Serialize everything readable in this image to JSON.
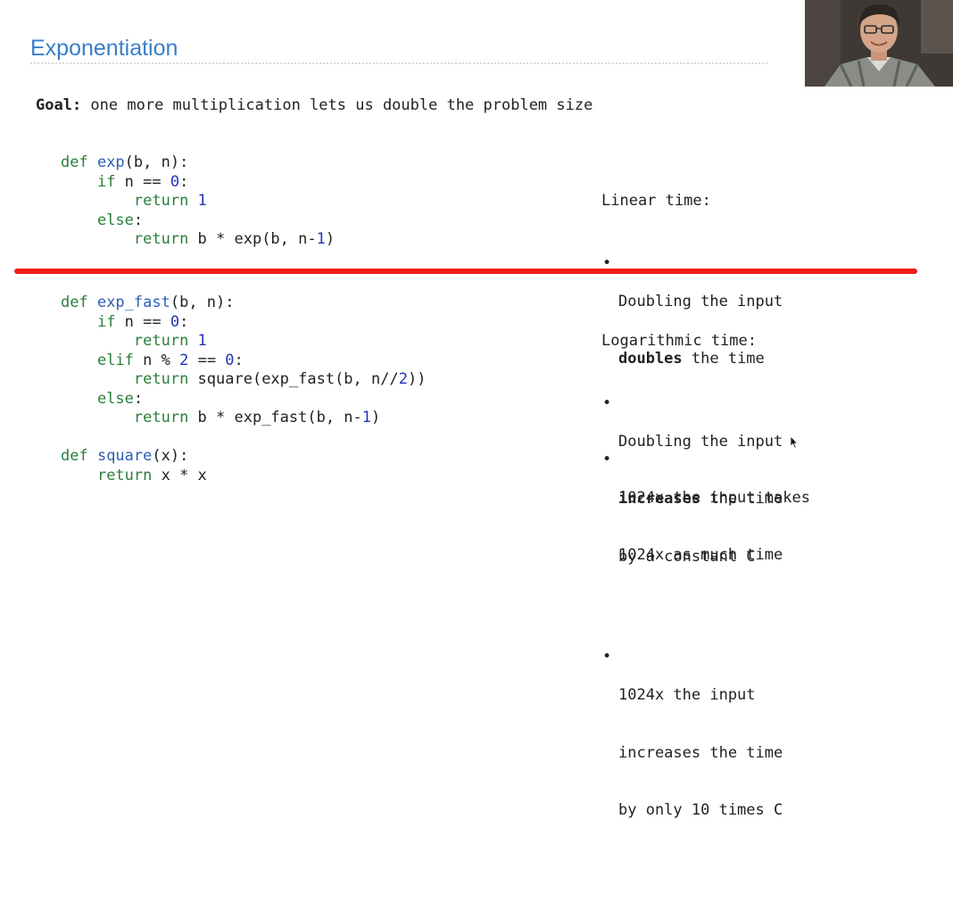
{
  "slide": {
    "title": "Exponentiation",
    "goal_label": "Goal:",
    "goal_text": " one more multiplication lets us double the problem size"
  },
  "linear": {
    "code": [
      [
        {
          "t": "def ",
          "c": "kw"
        },
        {
          "t": "exp",
          "c": "fn"
        },
        {
          "t": "(b, n):",
          "c": ""
        }
      ],
      [
        {
          "t": "    ",
          "c": ""
        },
        {
          "t": "if",
          "c": "kw"
        },
        {
          "t": " n == ",
          "c": ""
        },
        {
          "t": "0",
          "c": "num"
        },
        {
          "t": ":",
          "c": ""
        }
      ],
      [
        {
          "t": "        ",
          "c": ""
        },
        {
          "t": "return ",
          "c": "kw"
        },
        {
          "t": "1",
          "c": "num"
        }
      ],
      [
        {
          "t": "    ",
          "c": ""
        },
        {
          "t": "else",
          "c": "kw"
        },
        {
          "t": ":",
          "c": ""
        }
      ],
      [
        {
          "t": "        ",
          "c": ""
        },
        {
          "t": "return",
          "c": "kw"
        },
        {
          "t": " b * exp(b, n-",
          "c": ""
        },
        {
          "t": "1",
          "c": "num"
        },
        {
          "t": ")",
          "c": ""
        }
      ]
    ],
    "heading": "Linear time:",
    "bullet1_line1": "Doubling the input",
    "bullet1_bold": "doubles",
    "bullet1_rest": " the time",
    "bullet2_line1": "1024x the input takes",
    "bullet2_line2": "1024x as much time"
  },
  "logarithmic": {
    "code": [
      [
        {
          "t": "def ",
          "c": "kw"
        },
        {
          "t": "exp_fast",
          "c": "fn"
        },
        {
          "t": "(b, n):",
          "c": ""
        }
      ],
      [
        {
          "t": "    ",
          "c": ""
        },
        {
          "t": "if",
          "c": "kw"
        },
        {
          "t": " n == ",
          "c": ""
        },
        {
          "t": "0",
          "c": "num"
        },
        {
          "t": ":",
          "c": ""
        }
      ],
      [
        {
          "t": "        ",
          "c": ""
        },
        {
          "t": "return ",
          "c": "kw"
        },
        {
          "t": "1",
          "c": "num"
        }
      ],
      [
        {
          "t": "    ",
          "c": ""
        },
        {
          "t": "elif",
          "c": "kw"
        },
        {
          "t": " n % ",
          "c": ""
        },
        {
          "t": "2",
          "c": "num"
        },
        {
          "t": " == ",
          "c": ""
        },
        {
          "t": "0",
          "c": "num"
        },
        {
          "t": ":",
          "c": ""
        }
      ],
      [
        {
          "t": "        ",
          "c": ""
        },
        {
          "t": "return",
          "c": "kw"
        },
        {
          "t": " square(exp_fast(b, n//",
          "c": ""
        },
        {
          "t": "2",
          "c": "num"
        },
        {
          "t": "))",
          "c": ""
        }
      ],
      [
        {
          "t": "    ",
          "c": ""
        },
        {
          "t": "else",
          "c": "kw"
        },
        {
          "t": ":",
          "c": ""
        }
      ],
      [
        {
          "t": "        ",
          "c": ""
        },
        {
          "t": "return",
          "c": "kw"
        },
        {
          "t": " b * exp_fast(b, n-",
          "c": ""
        },
        {
          "t": "1",
          "c": "num"
        },
        {
          "t": ")",
          "c": ""
        }
      ],
      [],
      [
        {
          "t": "def ",
          "c": "kw"
        },
        {
          "t": "square",
          "c": "fn"
        },
        {
          "t": "(x):",
          "c": ""
        }
      ],
      [
        {
          "t": "    ",
          "c": ""
        },
        {
          "t": "return",
          "c": "kw"
        },
        {
          "t": " x * x",
          "c": ""
        }
      ]
    ],
    "heading": "Logarithmic time:",
    "bullet1_line1": "Doubling the input",
    "bullet1_bold": "increases",
    "bullet1_rest": " the time",
    "bullet1_line3": "by a constant C",
    "bullet2_line1": "1024x the input",
    "bullet2_line2": "increases the time",
    "bullet2_line3": "by only 10 times C"
  },
  "colors": {
    "title": "#3a7fc8",
    "keyword": "#2a7e3a",
    "function_name": "#2a5fb5",
    "number": "#2333b8",
    "divider": "#ee1c14"
  },
  "icons": {
    "webcam": "presenter-webcam-video",
    "cursor": "mouse-pointer-icon"
  }
}
